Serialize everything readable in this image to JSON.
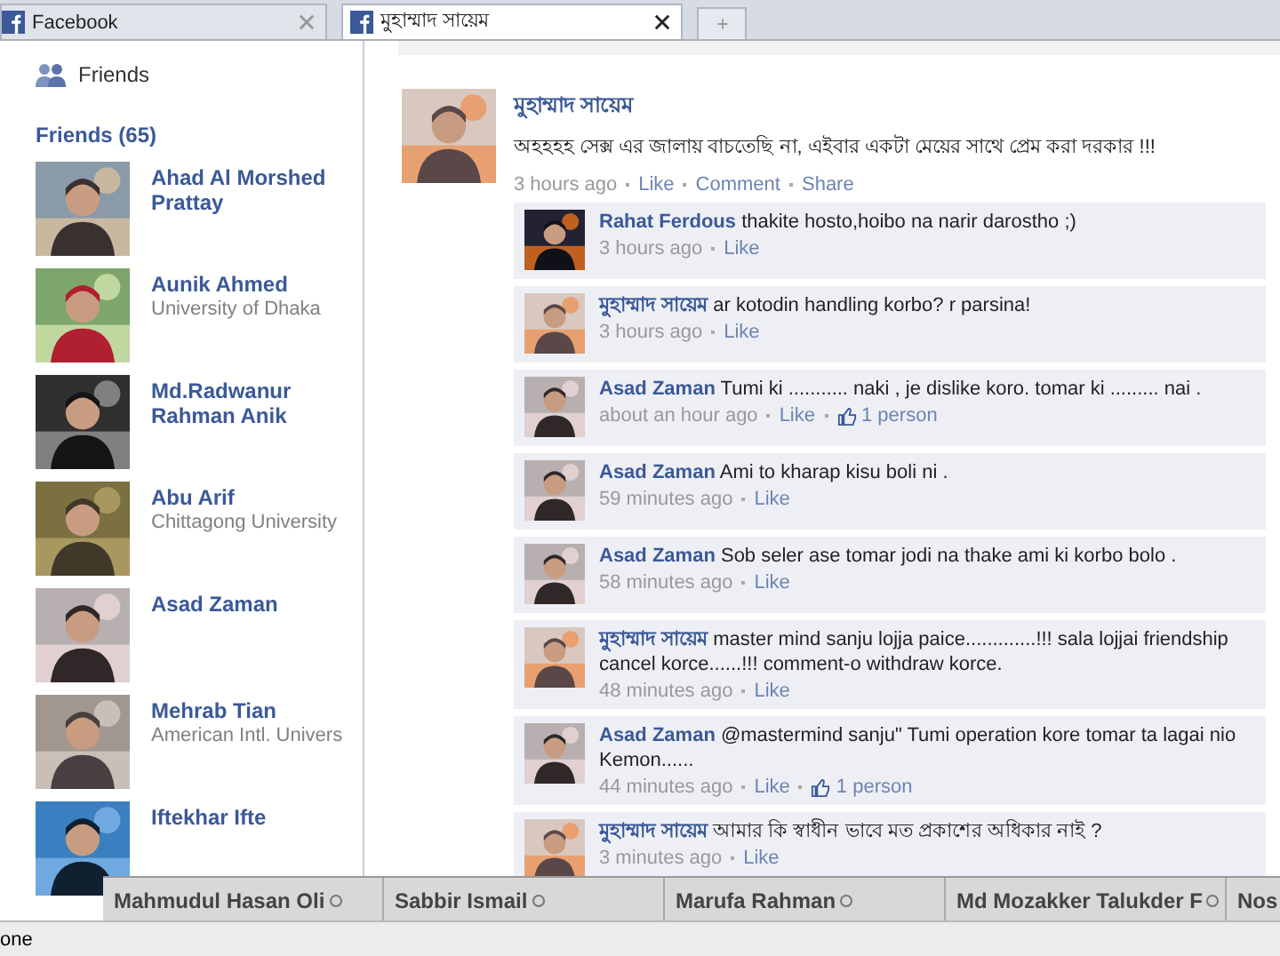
{
  "browser_tabs": [
    {
      "title": "Facebook",
      "selected": false
    },
    {
      "title": "মুহাম্মাদ সায়েম",
      "selected": true
    }
  ],
  "sidebar": {
    "nav_item": "Friends",
    "friends_heading": "Friends (65)",
    "friends": [
      {
        "name": "Ahad Al Morshed Prattay"
      },
      {
        "name": "Aunik Ahmed",
        "subtitle": "University of Dhaka"
      },
      {
        "name": "Md.Radwanur Rahman Anik"
      },
      {
        "name": "Abu Arif",
        "subtitle": "Chittagong University"
      },
      {
        "name": "Asad Zaman"
      },
      {
        "name": "Mehrab Tian",
        "subtitle": "American Intl. Univers"
      },
      {
        "name": "Iftekhar Ifte"
      }
    ]
  },
  "post": {
    "author": "মুহাম্মাদ সায়েম",
    "text": "অহহহহ সেক্স এর জালায় বাচতেছি না, এইবার একটা মেয়ের সাথে প্রেম করা দরকার !!!",
    "time": "3 hours ago",
    "actions": [
      "Like",
      "Comment",
      "Share"
    ],
    "comments": [
      {
        "author": "Rahat Ferdous",
        "text": "thakite hosto,hoibo na narir darostho ;)",
        "time": "3 hours ago",
        "like": "Like"
      },
      {
        "author": "মুহাম্মাদ সায়েম",
        "text": "ar kotodin handling korbo? r parsina!",
        "time": "3 hours ago",
        "like": "Like"
      },
      {
        "author": "Asad Zaman",
        "text": "Tumi ki ........... naki , je dislike koro. tomar ki ......... nai .",
        "time": "about an hour ago",
        "like": "Like",
        "likes": "1 person"
      },
      {
        "author": "Asad Zaman",
        "text": "Ami to kharap kisu boli ni .",
        "time": "59 minutes ago",
        "like": "Like"
      },
      {
        "author": "Asad Zaman",
        "text": "Sob seler ase tomar jodi na thake ami ki korbo bolo .",
        "time": "58 minutes ago",
        "like": "Like"
      },
      {
        "author": "মুহাম্মাদ সায়েম",
        "text": "master mind sanju lojja paice.............!!! sala lojjai friendship cancel korce......!!! comment-o withdraw korce.",
        "time": "48 minutes ago",
        "like": "Like"
      },
      {
        "author": "Asad Zaman",
        "text": "@mastermind sanju\" Tumi operation kore tomar ta lagai nio Kemon......",
        "time": "44 minutes ago",
        "like": "Like",
        "likes": "1 person"
      },
      {
        "author": "মুহাম্মাদ সায়েম",
        "text": "আমার কি স্বাধীন ভাবে মত প্রকাশের অধিকার নাই ?",
        "time": "3 minutes ago",
        "like": "Like"
      }
    ]
  },
  "chat_bar": [
    {
      "name": "Mahmudul Hasan Oli",
      "status_ring": true
    },
    {
      "name": "Sabbir Ismail",
      "status_ring": true
    },
    {
      "name": "Marufa Rahman",
      "status_ring": true
    },
    {
      "name": "Md Mozakker Talukder F",
      "status_ring": true
    },
    {
      "name": "Nos",
      "status_ring": false
    }
  ],
  "status_bar": "one"
}
